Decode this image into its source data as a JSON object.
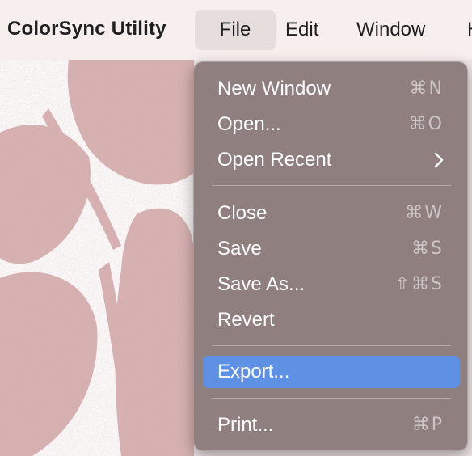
{
  "menubar": {
    "app_name": "ColorSync Utility",
    "menus": [
      "File",
      "Edit",
      "Window",
      "H"
    ]
  },
  "file_menu": {
    "items": [
      {
        "label": "New Window",
        "shortcut": "⌘N"
      },
      {
        "label": "Open...",
        "shortcut": "⌘O"
      },
      {
        "label": "Open Recent",
        "submenu_icon": "chevron-right-icon"
      },
      {
        "label": "Close",
        "shortcut": "⌘W"
      },
      {
        "label": "Save",
        "shortcut": "⌘S"
      },
      {
        "label": "Save As...",
        "shortcut": "⇧⌘S"
      },
      {
        "label": "Revert",
        "shortcut": ""
      },
      {
        "label": "Export...",
        "shortcut": "",
        "highlighted": true
      },
      {
        "label": "Print...",
        "shortcut": "⌘P"
      }
    ],
    "highlight_color": "#5e90e3"
  }
}
